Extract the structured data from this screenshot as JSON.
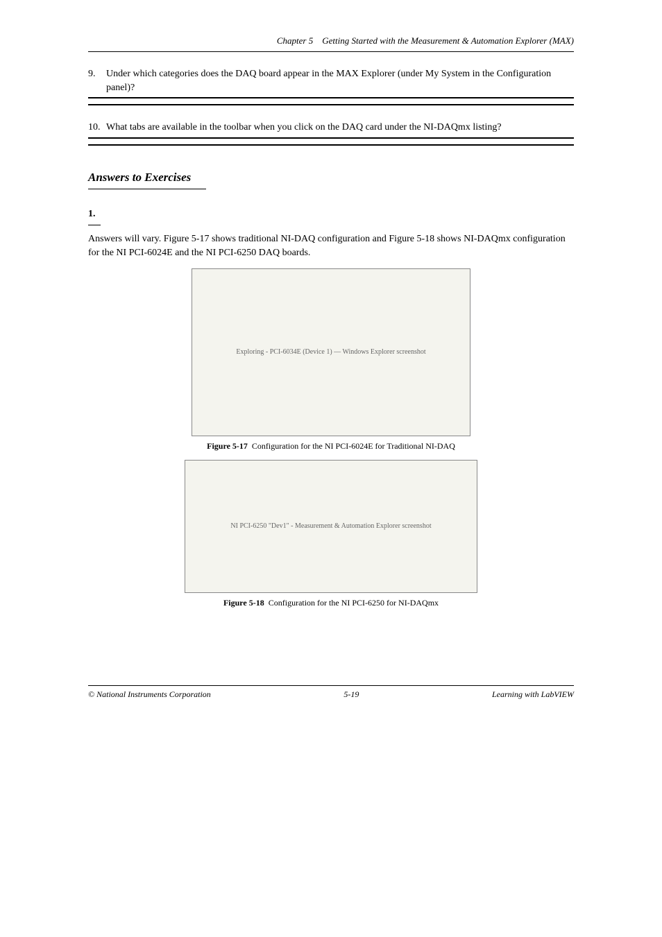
{
  "header": {
    "chapter": "Chapter 5",
    "title": "Getting Started with the Measurement & Automation Explorer (MAX)"
  },
  "items": [
    {
      "number": "9.",
      "text": "Under which categories does the DAQ board appear in the MAX Explorer (under My System in the Configuration panel)?"
    },
    {
      "number": "10.",
      "text": "What tabs are available in the toolbar when you click on the DAQ card under the NI-DAQmx listing?"
    }
  ],
  "sectionHeading": "Answers to Exercises",
  "answers": [
    {
      "number": "1.",
      "text": "Answers will vary. Figure 5-17 shows traditional NI-DAQ configuration and Figure 5-18 shows NI-DAQmx configuration for the NI PCI-6024E and the NI PCI-6250 DAQ boards."
    }
  ],
  "figures": [
    {
      "alt": "Exploring - PCI-6034E (Device 1) — Windows Explorer screenshot",
      "caption_bold": "Figure 5-17",
      "caption_text": "Configuration for the NI PCI-6024E for Traditional NI-DAQ"
    },
    {
      "alt": "NI PCI-6250 \"Dev1\" - Measurement & Automation Explorer screenshot",
      "caption_bold": "Figure 5-18",
      "caption_text": "Configuration for the NI PCI-6250 for NI-DAQmx"
    }
  ],
  "footer": {
    "left": "© National Instruments Corporation",
    "center": "5-19",
    "right": "Learning with LabVIEW"
  }
}
